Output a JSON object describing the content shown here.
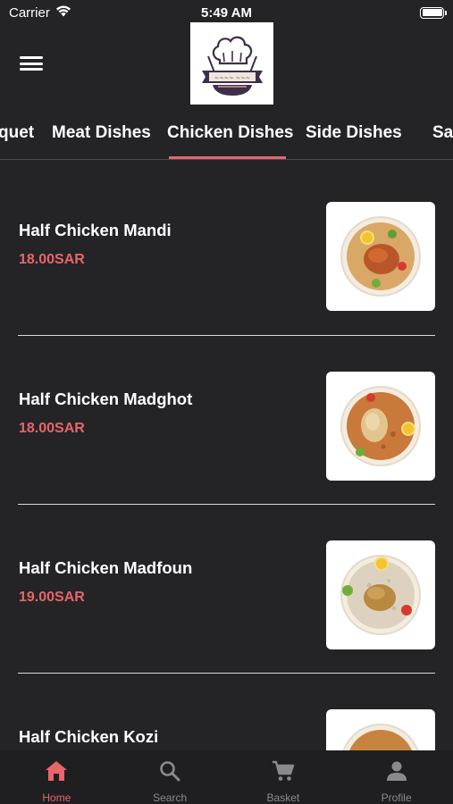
{
  "status_bar": {
    "carrier": "Carrier",
    "time": "5:49 AM"
  },
  "header": {
    "menu_icon": "hamburger-menu-icon",
    "logo_alt": "restaurant-chef-logo"
  },
  "tabs": {
    "items": [
      {
        "label": "quet"
      },
      {
        "label": "Meat Dishes"
      },
      {
        "label": "Chicken Dishes"
      },
      {
        "label": "Side Dishes"
      },
      {
        "label": "Sa"
      }
    ],
    "active_index": 2
  },
  "menu_items": [
    {
      "name": "Half Chicken Mandi",
      "price": "18.00SAR"
    },
    {
      "name": "Half Chicken Madghot",
      "price": "18.00SAR"
    },
    {
      "name": "Half Chicken Madfoun",
      "price": "19.00SAR"
    },
    {
      "name": "Half Chicken Kozi",
      "price": ""
    }
  ],
  "bottom_nav": {
    "items": [
      {
        "label": "Home",
        "icon": "home-icon",
        "active": true
      },
      {
        "label": "Search",
        "icon": "search-icon",
        "active": false
      },
      {
        "label": "Basket",
        "icon": "cart-icon",
        "active": false
      },
      {
        "label": "Profile",
        "icon": "person-icon",
        "active": false
      }
    ]
  },
  "colors": {
    "background": "#242427",
    "accent": "#e8656a",
    "nav_background": "#1f1f22",
    "inactive": "#8a8a8e"
  }
}
